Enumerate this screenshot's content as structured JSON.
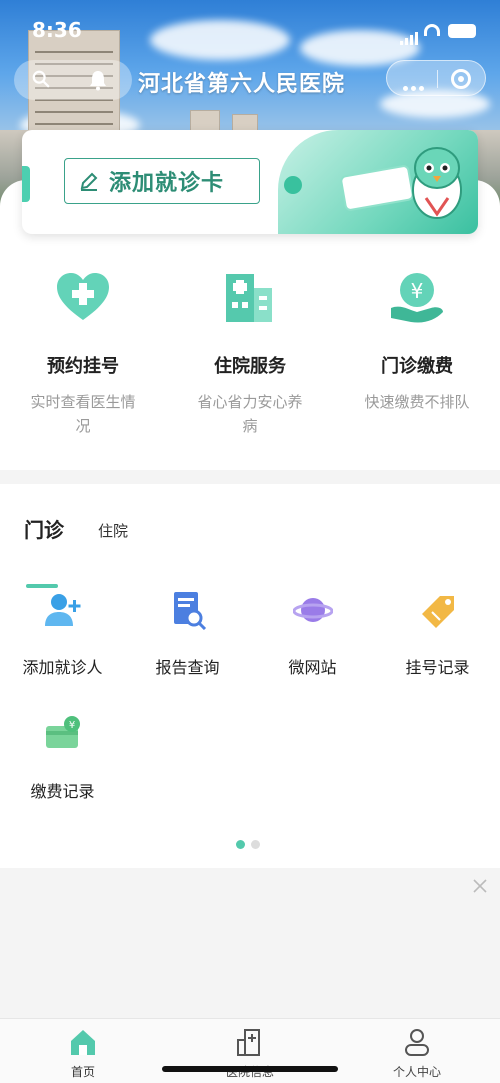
{
  "status_bar": {
    "time": "8:36"
  },
  "header": {
    "title": "河北省第六人民医院"
  },
  "banner": {
    "add_card_label": "添加就诊卡"
  },
  "services": [
    {
      "name": "预约挂号",
      "desc": "实时查看医生情况",
      "icon": "heart-plus-icon"
    },
    {
      "name": "住院服务",
      "desc": "省心省力安心养病",
      "icon": "hospital-building-icon"
    },
    {
      "name": "门诊缴费",
      "desc": "快速缴费不排队",
      "icon": "yuan-hand-icon"
    }
  ],
  "tabs": {
    "active": "门诊",
    "inactive": "住院"
  },
  "grid": [
    {
      "label": "添加就诊人",
      "icon": "add-user-icon"
    },
    {
      "label": "报告查询",
      "icon": "report-search-icon"
    },
    {
      "label": "微网站",
      "icon": "planet-icon"
    },
    {
      "label": "挂号记录",
      "icon": "tag-icon"
    },
    {
      "label": "缴费记录",
      "icon": "payment-card-icon"
    }
  ],
  "pager": {
    "pages": 2,
    "current": 1
  },
  "bottom_nav": [
    {
      "label": "首页",
      "icon": "home-icon",
      "active": true
    },
    {
      "label": "医院信息",
      "icon": "hospital-info-icon",
      "active": false
    },
    {
      "label": "个人中心",
      "icon": "user-icon",
      "active": false
    }
  ],
  "colors": {
    "accent": "#53c9ac",
    "accent_dark": "#2d8d75",
    "gray_text": "#9a9a9a"
  }
}
